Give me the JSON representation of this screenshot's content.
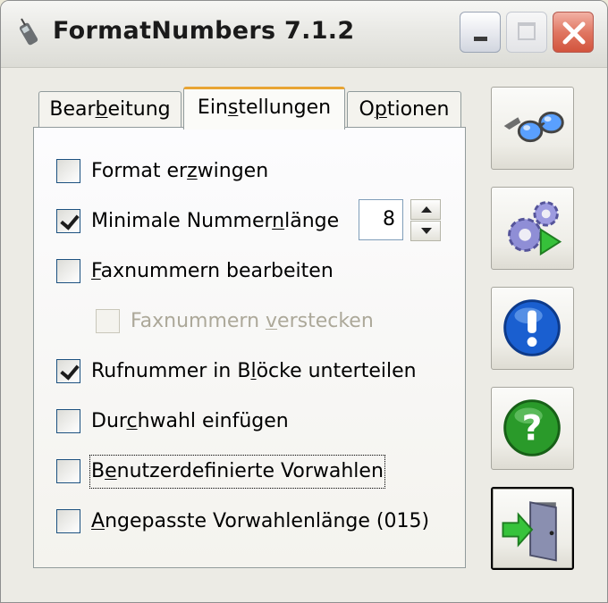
{
  "window": {
    "title": "FormatNumbers 7.1.2"
  },
  "tabs": [
    {
      "pre": "Bear",
      "key": "b",
      "post": "eitung",
      "selected": false
    },
    {
      "pre": "Ein",
      "key": "s",
      "post": "tellungen",
      "selected": true
    },
    {
      "pre": "O",
      "key": "p",
      "post": "tionen",
      "selected": false
    }
  ],
  "options": [
    {
      "pre": "Format er",
      "key": "z",
      "post": "wingen",
      "checked": false,
      "enabled": true
    },
    {
      "pre": "Minimale Nummer",
      "key": "n",
      "post": "länge",
      "checked": true,
      "enabled": true
    },
    {
      "pre": "",
      "key": "F",
      "post": "axnummern bearbeiten",
      "checked": false,
      "enabled": true
    },
    {
      "pre": "Faxnummern ",
      "key": "v",
      "post": "erstecken",
      "checked": false,
      "enabled": false
    },
    {
      "pre": "Rufnummer in B",
      "key": "l",
      "post": "öcke unterteilen",
      "checked": true,
      "enabled": true
    },
    {
      "pre": "Dur",
      "key": "c",
      "post": "hwahl einfügen",
      "checked": false,
      "enabled": true
    },
    {
      "pre": "B",
      "key": "e",
      "post": "nutzerdefinierte Vorwahlen",
      "checked": false,
      "enabled": true,
      "focused": true
    },
    {
      "pre": "",
      "key": "A",
      "post": "ngepasste Vorwahlenlänge (015)",
      "checked": false,
      "enabled": true
    }
  ],
  "min_length": {
    "value": "8"
  },
  "side_buttons": [
    {
      "icon": "glasses-icon"
    },
    {
      "icon": "gears-play-icon"
    },
    {
      "icon": "info-exclamation-icon"
    },
    {
      "icon": "help-question-icon"
    },
    {
      "icon": "exit-door-icon"
    }
  ],
  "colors": {
    "tab_highlight": "#e8a534",
    "info_blue": "#1a5fd0",
    "help_green": "#2a9a2a"
  }
}
